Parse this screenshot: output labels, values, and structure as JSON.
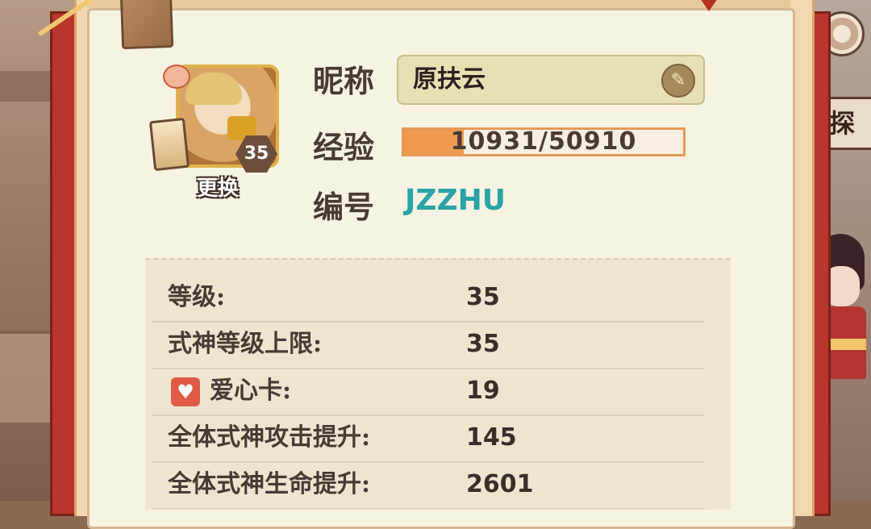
{
  "background": {
    "explore_label": "探索"
  },
  "profile": {
    "level_badge": "35",
    "change_label": "更换",
    "nickname_label": "昵称",
    "nickname_value": "原扶云",
    "exp_label": "经验",
    "exp_current": 10931,
    "exp_max": 50910,
    "exp_text": "10931/50910",
    "id_label": "编号",
    "id_value": "JZZHU"
  },
  "stats": [
    {
      "label": "等级:",
      "value": "35"
    },
    {
      "label": "式神等级上限:",
      "value": "35"
    },
    {
      "label": "爱心卡:",
      "value": "19",
      "icon": "heart-card-icon"
    },
    {
      "label": "全体式神攻击提升:",
      "value": "145"
    },
    {
      "label": "全体式神生命提升:",
      "value": "2601"
    }
  ],
  "colors": {
    "id_teal": "#29a3a6",
    "exp_orange": "#ef9a4f",
    "frame_red": "#b8362b"
  }
}
